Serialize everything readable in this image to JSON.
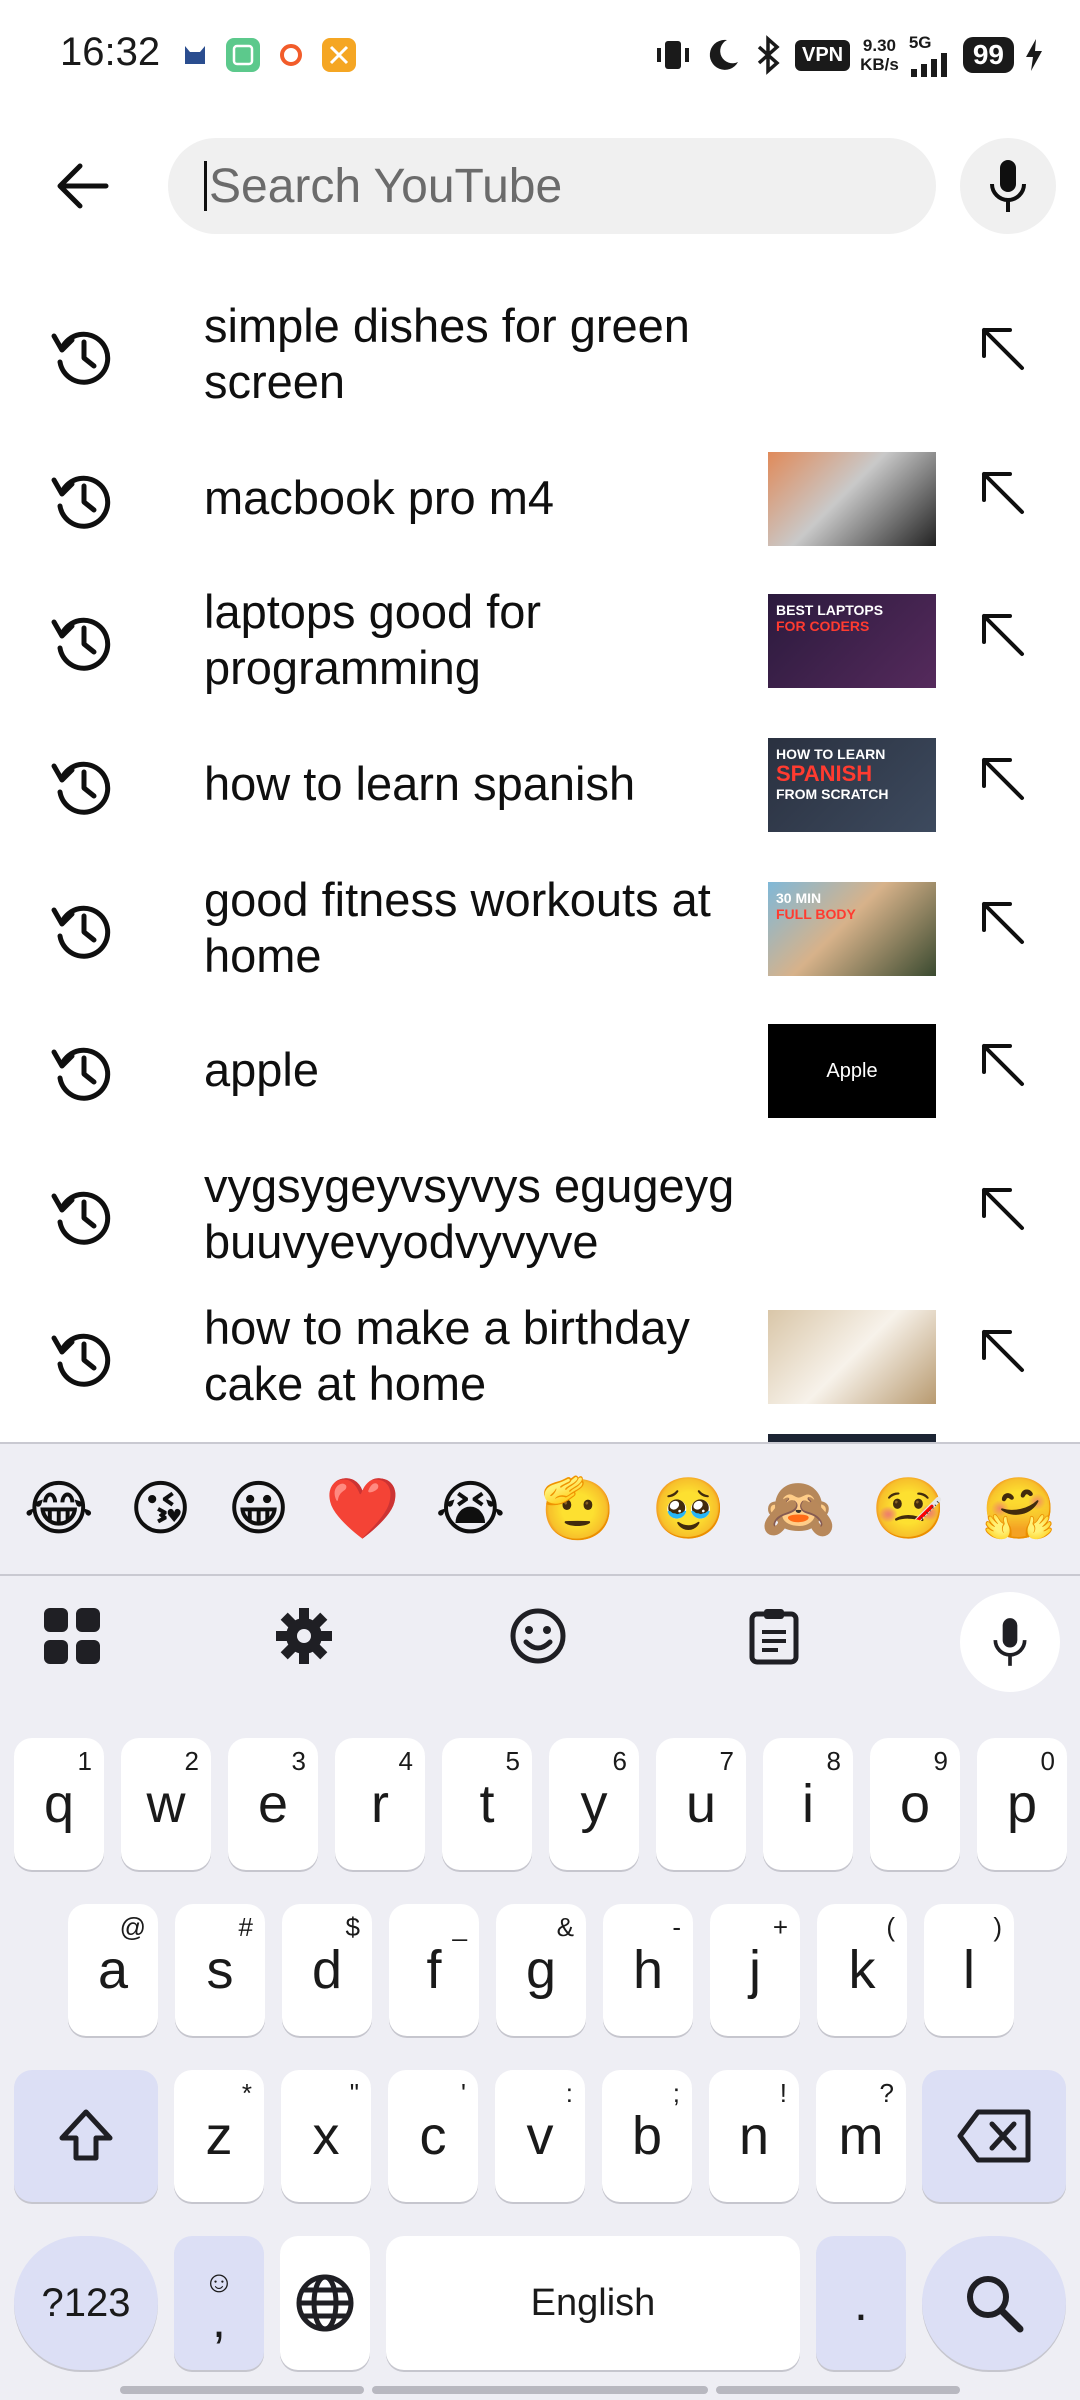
{
  "status_bar": {
    "time": "16:32",
    "vpn": "VPN",
    "speed_value": "9.30",
    "speed_unit": "KB/s",
    "network": "5G",
    "battery": "99"
  },
  "search": {
    "placeholder": "Search YouTube"
  },
  "suggestions": [
    {
      "text": "simple dishes for green screen",
      "thumbnail": null
    },
    {
      "text": "macbook pro m4",
      "thumbnail": {
        "type": "photo"
      }
    },
    {
      "text": "laptops good for programming",
      "thumbnail": {
        "type": "title-card",
        "lines": [
          "BEST LAPTOPS",
          "FOR CODERS"
        ]
      }
    },
    {
      "text": "how to learn spanish",
      "thumbnail": {
        "type": "title-card",
        "lines": [
          "HOW TO LEARN",
          "SPANISH",
          "FROM SCRATCH"
        ]
      }
    },
    {
      "text": "good fitness workouts at home",
      "thumbnail": {
        "type": "title-card",
        "lines": [
          "30 MIN",
          "FULL BODY"
        ]
      }
    },
    {
      "text": "apple",
      "thumbnail": {
        "type": "text",
        "lines": [
          "Apple"
        ]
      }
    },
    {
      "text": "vygsygeyvsyvys egugeyg buuvyevyodvyvyve",
      "thumbnail": null
    },
    {
      "text": "how to make a birthday cake at home",
      "thumbnail": {
        "type": "photo"
      }
    }
  ],
  "keyboard": {
    "emojis": [
      "😂",
      "😘",
      "😀",
      "❤️",
      "😭",
      "🫡",
      "🥹",
      "🙈",
      "🤒",
      "🤗"
    ],
    "row1": [
      {
        "key": "q",
        "hint": "1"
      },
      {
        "key": "w",
        "hint": "2"
      },
      {
        "key": "e",
        "hint": "3"
      },
      {
        "key": "r",
        "hint": "4"
      },
      {
        "key": "t",
        "hint": "5"
      },
      {
        "key": "y",
        "hint": "6"
      },
      {
        "key": "u",
        "hint": "7"
      },
      {
        "key": "i",
        "hint": "8"
      },
      {
        "key": "o",
        "hint": "9"
      },
      {
        "key": "p",
        "hint": "0"
      }
    ],
    "row2": [
      {
        "key": "a",
        "hint": "@"
      },
      {
        "key": "s",
        "hint": "#"
      },
      {
        "key": "d",
        "hint": "$"
      },
      {
        "key": "f",
        "hint": "_"
      },
      {
        "key": "g",
        "hint": "&"
      },
      {
        "key": "h",
        "hint": "-"
      },
      {
        "key": "j",
        "hint": "+"
      },
      {
        "key": "k",
        "hint": "("
      },
      {
        "key": "l",
        "hint": ")"
      }
    ],
    "row3": [
      {
        "key": "z",
        "hint": "*"
      },
      {
        "key": "x",
        "hint": "\""
      },
      {
        "key": "c",
        "hint": "'"
      },
      {
        "key": "v",
        "hint": ":"
      },
      {
        "key": "b",
        "hint": ";"
      },
      {
        "key": "n",
        "hint": "!"
      },
      {
        "key": "m",
        "hint": "?"
      }
    ],
    "symbols_label": "?123",
    "comma_label": ",",
    "space_label": "English",
    "period_label": "."
  },
  "icons": {
    "back": "back-arrow-icon",
    "mic": "microphone-icon",
    "history": "history-icon",
    "fill": "arrow-up-left-icon",
    "apps": "apps-grid-icon",
    "settings": "gear-icon",
    "emoji": "smiley-icon",
    "clipboard": "clipboard-icon",
    "shift": "shift-icon",
    "backspace": "backspace-icon",
    "globe": "globe-icon",
    "search": "search-icon"
  },
  "colors": {
    "search_bg": "#f0f0f0",
    "keyboard_bg": "#eeeef4",
    "mod_key": "#dcdff5"
  }
}
